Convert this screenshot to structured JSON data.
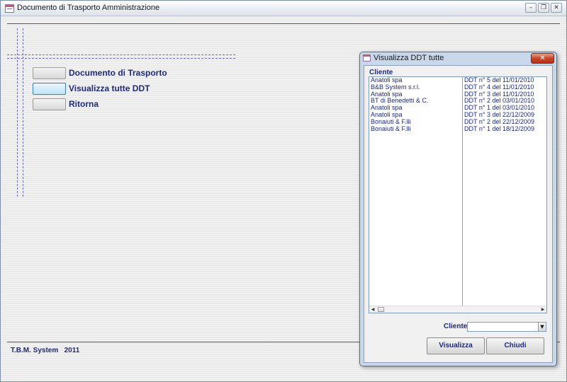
{
  "window": {
    "title": "Documento di Trasporto Amministrazione",
    "controls": {
      "minimize": "–",
      "restore": "❐",
      "close": "✕"
    }
  },
  "menu": {
    "items": [
      {
        "label": "Documento di Trasporto",
        "selected": false
      },
      {
        "label": "Visualizza tutte DDT",
        "selected": true
      },
      {
        "label": "Ritorna",
        "selected": false
      }
    ]
  },
  "footer": {
    "text": "T.B.M. System   2011"
  },
  "dialog": {
    "title": "Visualizza DDT tutte",
    "close_glyph": "✕",
    "list_header": "Cliente",
    "rows": [
      {
        "cliente": "Anatoli spa",
        "ddt": "DDT n° 5 del 11/01/2010"
      },
      {
        "cliente": "B&B System s.r.l.",
        "ddt": "DDT n° 4 del 11/01/2010"
      },
      {
        "cliente": "Anatoli spa",
        "ddt": "DDT n° 3 del 11/01/2010"
      },
      {
        "cliente": "BT di Benedetti & C.",
        "ddt": "DDT n° 2 del 03/01/2010"
      },
      {
        "cliente": "Anatoli spa",
        "ddt": "DDT n° 1 del 03/01/2010"
      },
      {
        "cliente": "Anatoli spa",
        "ddt": "DDT n° 3 del 22/12/2009"
      },
      {
        "cliente": "Bonaiuti & F.lli",
        "ddt": "DDT n° 2 del 22/12/2009"
      },
      {
        "cliente": "Bonaiuti & F.lli",
        "ddt": "DDT n° 1 del 18/12/2009"
      }
    ],
    "filter_label": "Cliente",
    "filter_value": "",
    "buttons": {
      "visualizza": "Visualizza",
      "chiudi": "Chiudi"
    }
  },
  "colors": {
    "label_text": "#1e2a78",
    "dialog_frame": "#c8d8ea",
    "close_button": "#c8452a"
  },
  "icons": {
    "app": "form-icon",
    "scroll_left": "arrow-left-icon",
    "scroll_right": "arrow-right-icon",
    "combo": "chevron-down-icon"
  }
}
